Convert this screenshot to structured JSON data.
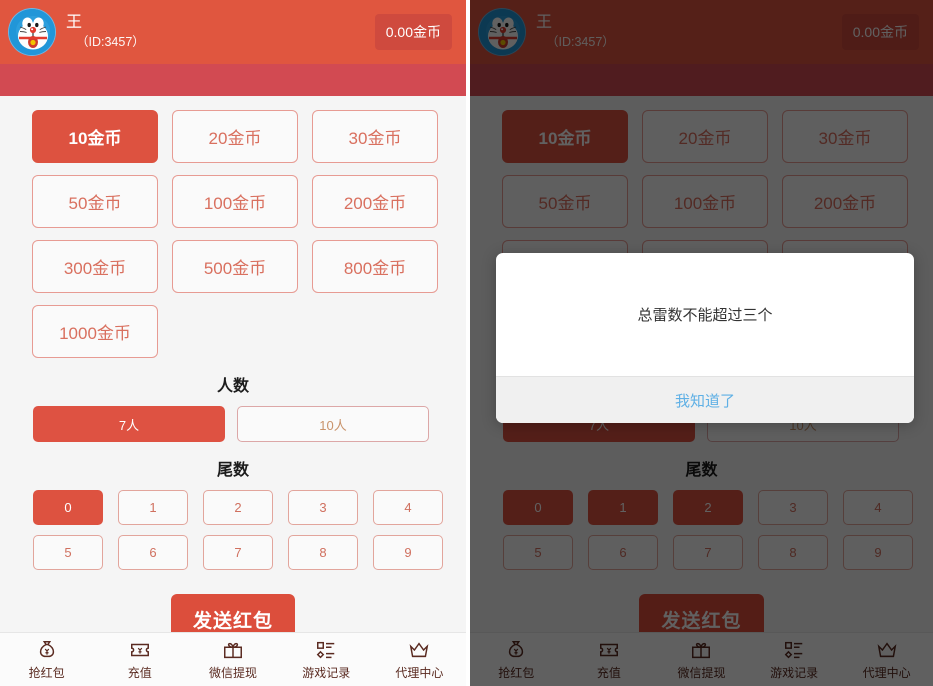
{
  "header": {
    "avatar_icon": "doraemon-avatar",
    "user_name": "王",
    "user_id": "（ID:3457）",
    "balance": "0.00金币"
  },
  "amounts": [
    {
      "label": "10金币",
      "selected": true
    },
    {
      "label": "20金币",
      "selected": false
    },
    {
      "label": "30金币",
      "selected": false
    },
    {
      "label": "50金币",
      "selected": false
    },
    {
      "label": "100金币",
      "selected": false
    },
    {
      "label": "200金币",
      "selected": false
    },
    {
      "label": "300金币",
      "selected": false
    },
    {
      "label": "500金币",
      "selected": false
    },
    {
      "label": "800金币",
      "selected": false
    },
    {
      "label": "1000金币",
      "selected": false
    }
  ],
  "people": {
    "title": "人数",
    "options": [
      {
        "label": "7人",
        "selected": true
      },
      {
        "label": "10人",
        "selected": false
      }
    ]
  },
  "tail": {
    "title": "尾数",
    "left_selected": [
      "0"
    ],
    "right_selected": [
      "0",
      "1",
      "2"
    ],
    "digits": [
      "0",
      "1",
      "2",
      "3",
      "4",
      "5",
      "6",
      "7",
      "8",
      "9"
    ]
  },
  "send": {
    "label": "发送红包"
  },
  "tabbar": [
    {
      "label": "抢红包",
      "icon": "money-bag-icon"
    },
    {
      "label": "充值",
      "icon": "ticket-icon"
    },
    {
      "label": "微信提现",
      "icon": "gift-icon"
    },
    {
      "label": "游戏记录",
      "icon": "list-icon"
    },
    {
      "label": "代理中心",
      "icon": "crown-icon"
    }
  ],
  "modal": {
    "message": "总雷数不能超过三个",
    "ok_label": "我知道了"
  },
  "colors": {
    "header_top": "#e0563f",
    "header_curve": "#d24a52",
    "accent": "#dd5240",
    "accent_border": "#e79b93",
    "page_bg": "#f5f5f5",
    "tab_text": "#5a2a20",
    "modal_link": "#5fb0e5",
    "overlay": "rgba(0,0,0,0.62)"
  }
}
